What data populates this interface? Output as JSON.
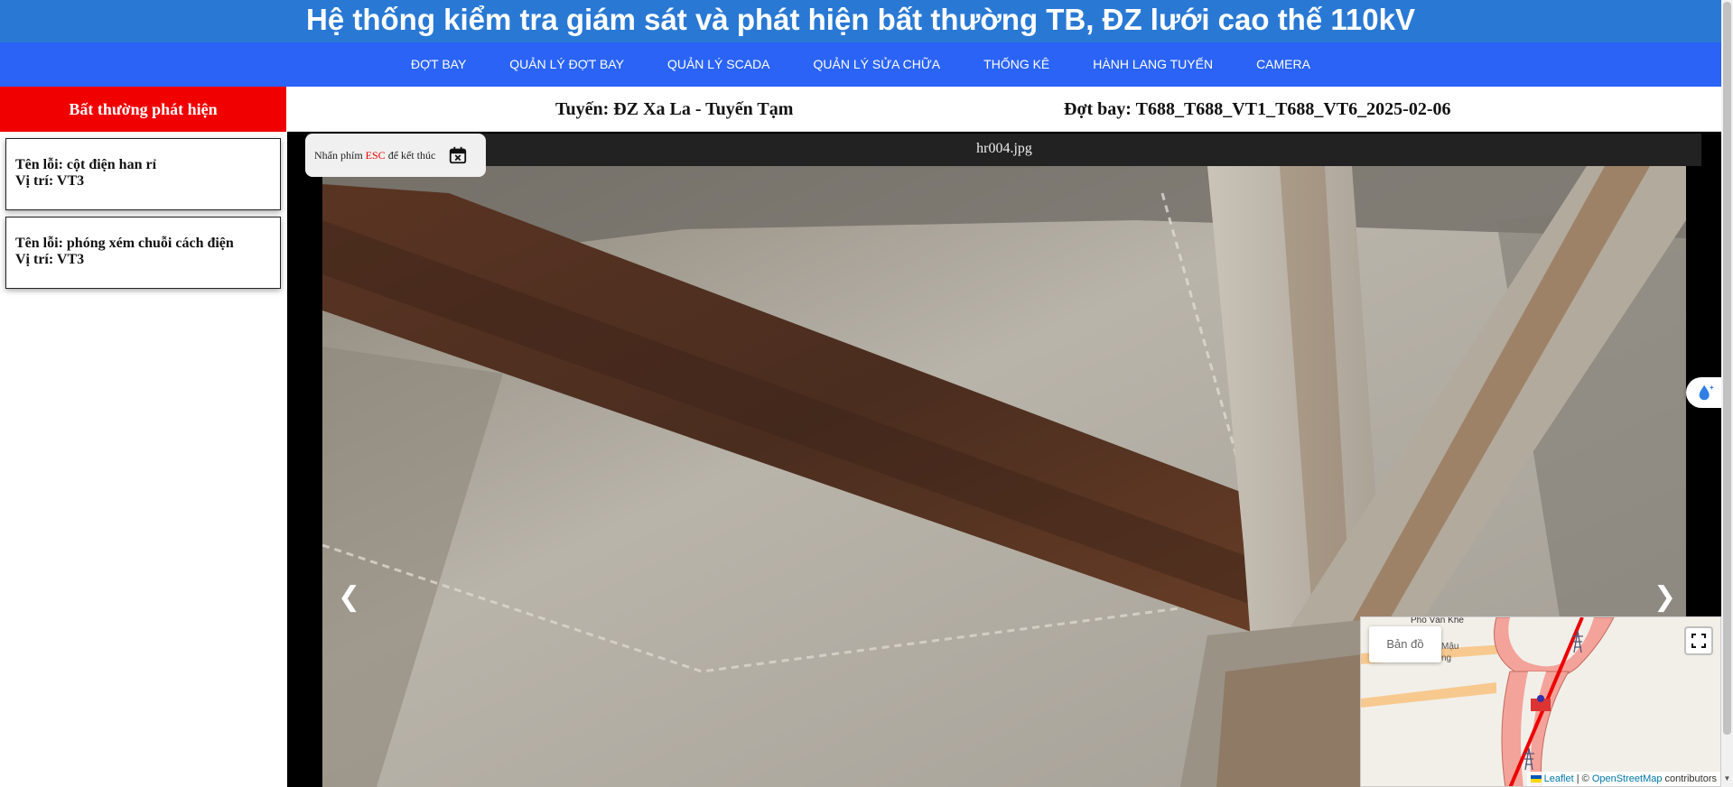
{
  "app": {
    "title": "Hệ thống kiểm tra giám sát và phát hiện bất thường TB, ĐZ lưới cao thế 110kV"
  },
  "nav": {
    "items": [
      {
        "label": "ĐỢT BAY"
      },
      {
        "label": "QUẢN LÝ ĐỢT BAY"
      },
      {
        "label": "QUẢN LÝ SCADA"
      },
      {
        "label": "QUẢN LÝ SỬA CHỮA"
      },
      {
        "label": "THỐNG KÊ"
      },
      {
        "label": "HÀNH LANG TUYẾN"
      },
      {
        "label": "CAMERA"
      }
    ]
  },
  "sidebar": {
    "header": "Bất thường phát hiện",
    "errors": [
      {
        "name": "Tên lỗi: cột điện han rỉ",
        "position": "Vị trí: VT3"
      },
      {
        "name": "Tên lỗi: phóng xém chuỗi cách điện",
        "position": "Vị trí: VT3"
      }
    ]
  },
  "header": {
    "route": "Tuyến: ĐZ Xa La - Tuyến Tạm",
    "flight": "Đợt bay: T688_T688_VT1_T688_VT6_2025-02-06"
  },
  "viewer": {
    "filename": "hr004.jpg",
    "esc_prefix": "Nhấn phím",
    "esc_key": "ESC",
    "esc_suffix": "để kết thúc",
    "prev_arrow": "❮",
    "next_arrow": "❯"
  },
  "map": {
    "layer_label": "Bản đồ",
    "road_labels": [
      "Phố Văn Khê",
      "Mậu",
      "ng"
    ],
    "attribution_leaflet": "Leaflet",
    "attribution_sep": " | © ",
    "attribution_osm": "OpenStreetMap",
    "attribution_suffix": " contributors"
  },
  "icons": {
    "calendar": "calendar-x-icon",
    "water_drop": "water-drop-icon",
    "fullscreen": "fullscreen-icon"
  },
  "colors": {
    "title_bg": "#2979d4",
    "nav_bg": "#2a63f5",
    "sidebar_header_bg": "#f00000",
    "esc_key": "#e00000"
  }
}
